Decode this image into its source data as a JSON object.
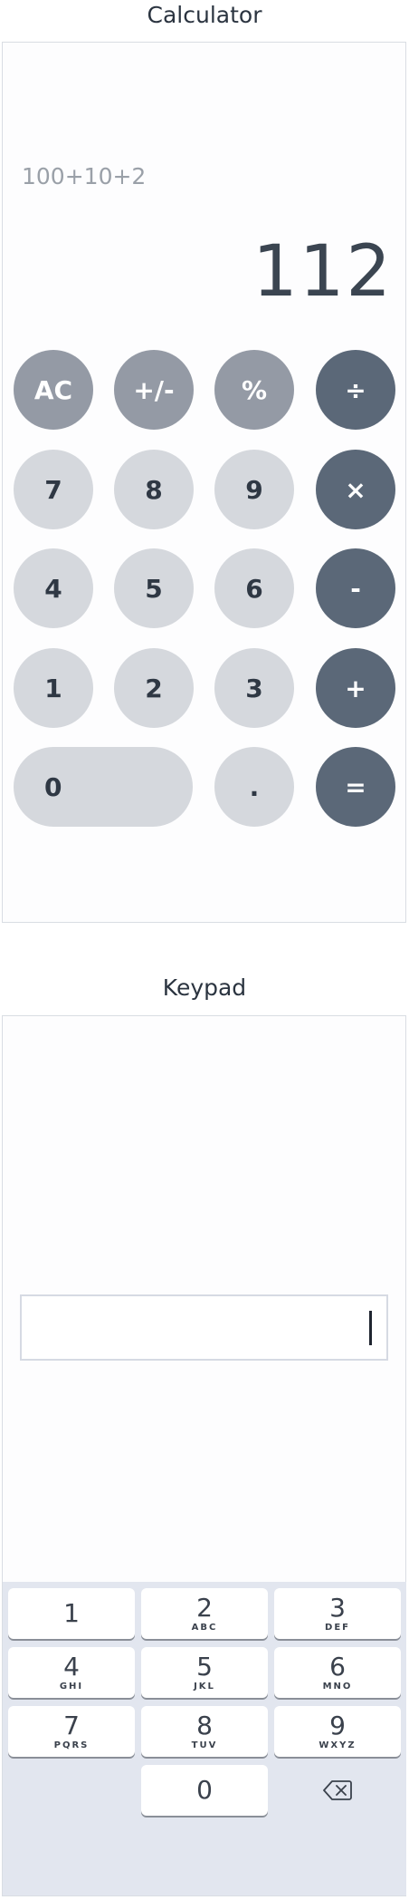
{
  "calculator": {
    "title": "Calculator",
    "expression": "100+10+2",
    "result": "112",
    "keys": {
      "ac": "AC",
      "sign": "+/-",
      "percent": "%",
      "divide": "÷",
      "seven": "7",
      "eight": "8",
      "nine": "9",
      "multiply": "×",
      "four": "4",
      "five": "5",
      "six": "6",
      "minus": "-",
      "one": "1",
      "two": "2",
      "three": "3",
      "plus": "+",
      "zero": "0",
      "dot": ".",
      "equals": "="
    },
    "colors": {
      "number_key": "#d5d8dd",
      "function_key": "#949aa5",
      "operator_key": "#5b6878"
    }
  },
  "keypad": {
    "title": "Keypad",
    "input_value": "",
    "keys": [
      {
        "digit": "1",
        "letters": ""
      },
      {
        "digit": "2",
        "letters": "ABC"
      },
      {
        "digit": "3",
        "letters": "DEF"
      },
      {
        "digit": "4",
        "letters": "GHI"
      },
      {
        "digit": "5",
        "letters": "JKL"
      },
      {
        "digit": "6",
        "letters": "MNO"
      },
      {
        "digit": "7",
        "letters": "PQRS"
      },
      {
        "digit": "8",
        "letters": "TUV"
      },
      {
        "digit": "9",
        "letters": "WXYZ"
      },
      {
        "digit": "0",
        "letters": ""
      }
    ],
    "backspace_icon": "backspace-icon"
  }
}
